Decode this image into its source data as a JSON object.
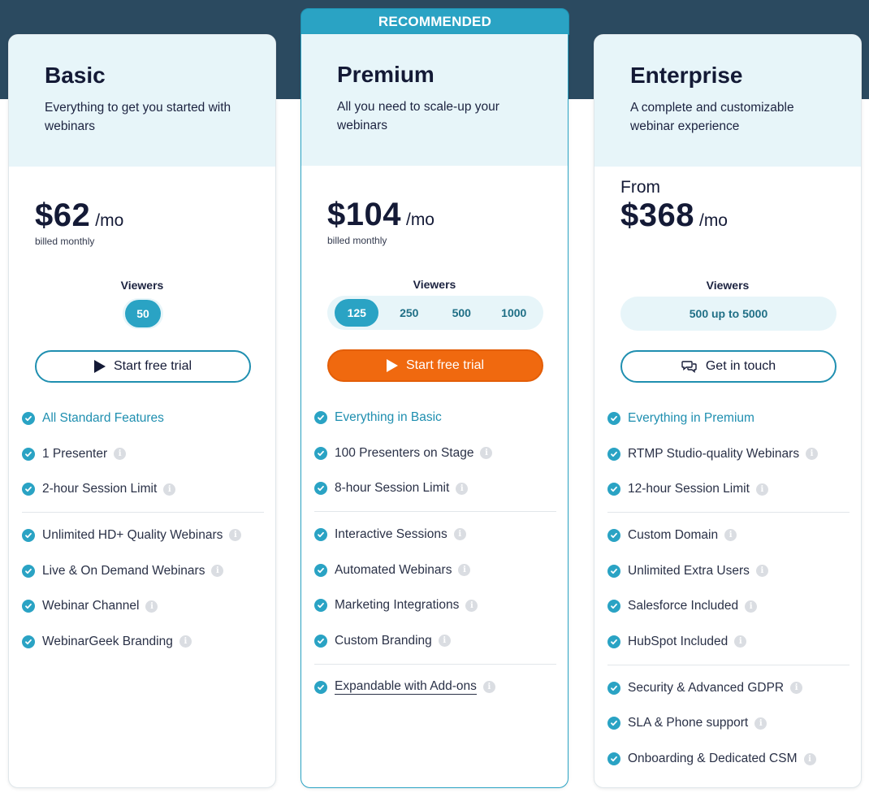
{
  "recommended_label": "RECOMMENDED",
  "viewers_label": "Viewers",
  "info_glyph": "i",
  "plans": {
    "basic": {
      "name": "Basic",
      "description": "Everything to get you started with webinars",
      "price": "$62",
      "per": "/mo",
      "billed": "billed monthly",
      "viewer_options": [
        "50"
      ],
      "selected_viewers": "50",
      "cta": "Start free trial",
      "cta_icon": "play-icon",
      "features": [
        {
          "text": "All Standard Features",
          "highlight": true,
          "info": false
        },
        {
          "text": "1 Presenter",
          "info": true
        },
        {
          "text": "2-hour Session Limit",
          "info": true
        },
        {
          "divider": true
        },
        {
          "text": "Unlimited HD+ Quality Webinars",
          "info": true
        },
        {
          "text": "Live & On Demand Webinars",
          "info": true
        },
        {
          "text": "Webinar Channel",
          "info": true
        },
        {
          "text": "WebinarGeek Branding",
          "info": true
        }
      ]
    },
    "premium": {
      "name": "Premium",
      "description": "All you need to scale-up your webinars",
      "price": "$104",
      "per": "/mo",
      "billed": "billed monthly",
      "viewer_options": [
        "125",
        "250",
        "500",
        "1000"
      ],
      "selected_viewers": "125",
      "cta": "Start free trial",
      "cta_icon": "play-icon",
      "features": [
        {
          "text": "Everything in Basic",
          "highlight": true,
          "info": false
        },
        {
          "text": "100 Presenters on Stage",
          "info": true
        },
        {
          "text": "8-hour Session Limit",
          "info": true
        },
        {
          "divider": true
        },
        {
          "text": "Interactive Sessions",
          "info": true
        },
        {
          "text": "Automated Webinars",
          "info": true
        },
        {
          "text": "Marketing Integrations",
          "info": true
        },
        {
          "text": "Custom Branding",
          "info": true
        },
        {
          "divider": true
        },
        {
          "text": "Expandable with Add-ons",
          "info": true,
          "underline": true
        }
      ]
    },
    "enterprise": {
      "name": "Enterprise",
      "description": "A complete and customizable webinar experience",
      "from": "From",
      "price": "$368",
      "per": "/mo",
      "viewer_range": "500 up to 5000",
      "cta": "Get in touch",
      "cta_icon": "chat-icon",
      "features": [
        {
          "text": "Everything in Premium",
          "highlight": true,
          "info": false
        },
        {
          "text": "RTMP Studio-quality Webinars",
          "info": true
        },
        {
          "text": "12-hour Session Limit",
          "info": true
        },
        {
          "divider": true
        },
        {
          "text": "Custom Domain",
          "info": true
        },
        {
          "text": "Unlimited Extra Users",
          "info": true
        },
        {
          "text": "Salesforce Included",
          "info": true
        },
        {
          "text": "HubSpot Included",
          "info": true
        },
        {
          "divider": true
        },
        {
          "text": "Security & Advanced GDPR",
          "info": true
        },
        {
          "text": "SLA & Phone support",
          "info": true
        },
        {
          "text": "Onboarding & Dedicated CSM",
          "info": true
        }
      ]
    }
  },
  "colors": {
    "accent": "#2aa3c4",
    "cta_orange": "#f0690f",
    "header_bg": "#e7f5f9",
    "top_band": "#2b4a60"
  }
}
